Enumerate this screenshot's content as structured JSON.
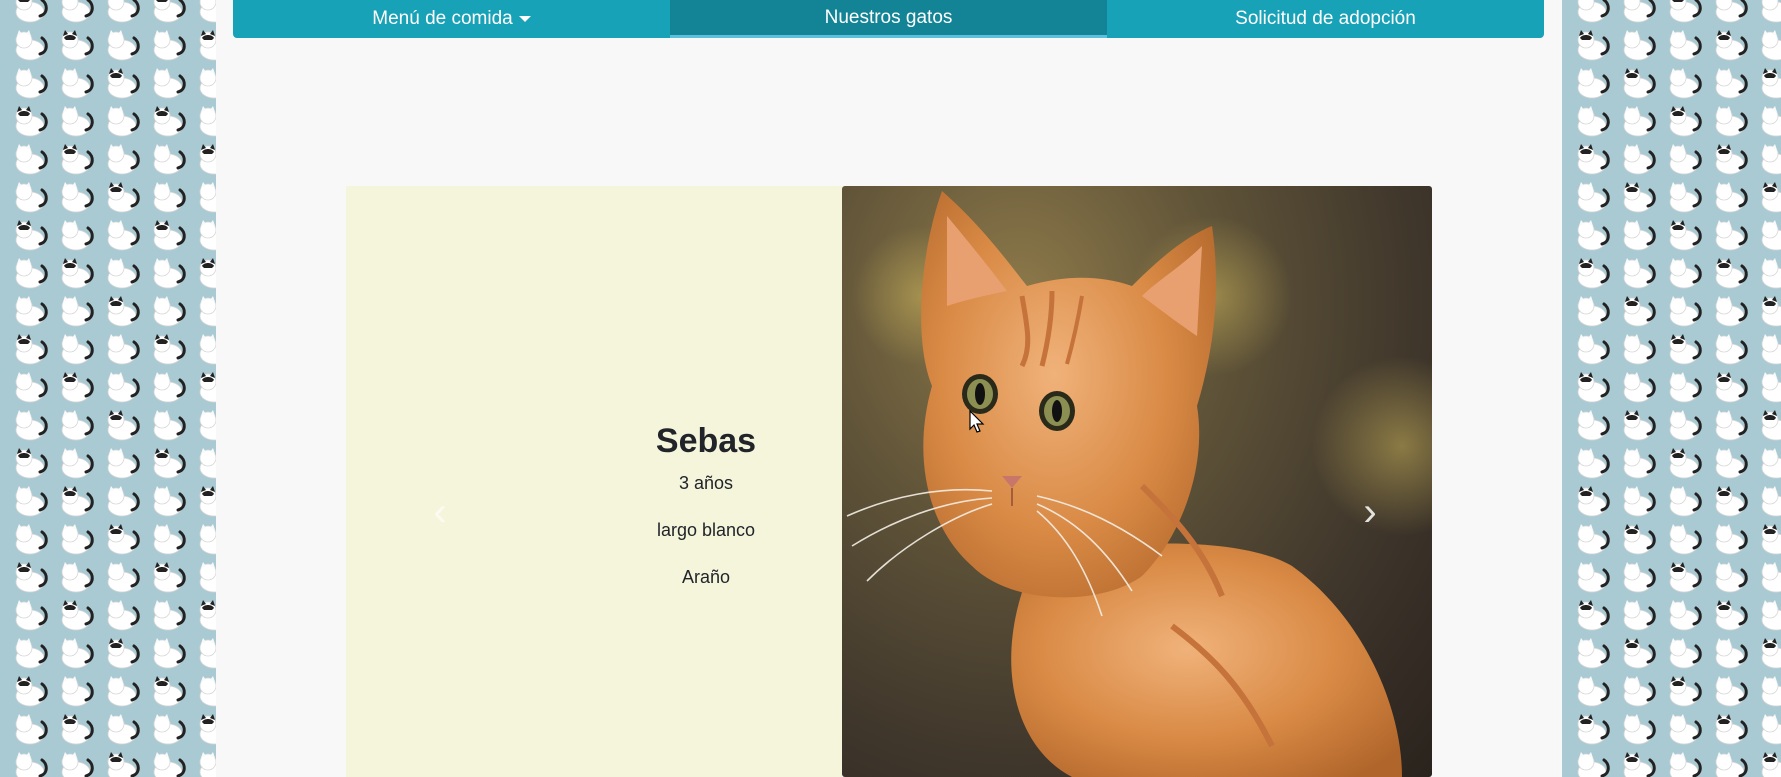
{
  "navbar": {
    "items": [
      {
        "label": "Menú de comida",
        "has_dropdown": true,
        "active": false
      },
      {
        "label": "Nuestros gatos",
        "has_dropdown": false,
        "active": true
      },
      {
        "label": "Solicitud de adopción",
        "has_dropdown": false,
        "active": false
      }
    ]
  },
  "carousel": {
    "cat": {
      "name": "Sebas",
      "age": "3 años",
      "fur": "largo blanco",
      "trait": "Araño"
    },
    "controls": {
      "prev_icon": "chevron-left-icon",
      "next_icon": "chevron-right-icon"
    }
  },
  "colors": {
    "navbar": "#17a2b8",
    "navbar_active": "#138496",
    "info_panel": "#f5f5dc",
    "page_bg": "#f8f8f8",
    "side_pattern": "#a9cad3"
  }
}
